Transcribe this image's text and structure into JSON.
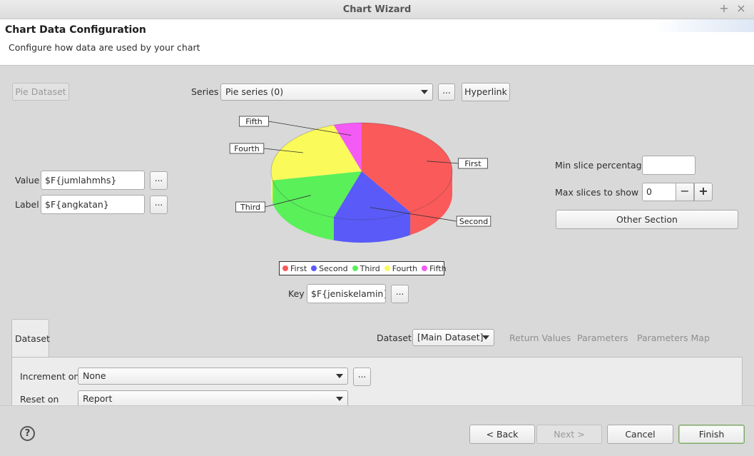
{
  "window": {
    "title": "Chart Wizard",
    "controls": [
      "+",
      "×"
    ]
  },
  "header": {
    "title": "Chart Data Configuration",
    "description": "Configure how data are used by your chart"
  },
  "dataset_button": {
    "label": "Pie Dataset"
  },
  "series": {
    "label": "Series",
    "selected": "Pie series (0)",
    "more_label": "...",
    "hyperlink_label": "Hyperlink"
  },
  "value": {
    "label": "Value",
    "expression": "$F{jumlahmhs}",
    "more_label": "..."
  },
  "label": {
    "label": "Label",
    "expression": "$F{angkatan}",
    "more_label": "..."
  },
  "key": {
    "label": "Key",
    "expression": "$F{jeniskelamin} +",
    "more_label": "..."
  },
  "min_slice": {
    "label": "Min slice percentage",
    "value": ""
  },
  "max_slices": {
    "label": "Max slices to show",
    "value": "0",
    "minus": "−",
    "plus": "+"
  },
  "other_section": {
    "label": "Other Section"
  },
  "chart_data": {
    "type": "pie",
    "labels": [
      "First",
      "Second",
      "Third",
      "Fourth",
      "Fifth"
    ],
    "values": [
      41,
      14,
      17,
      23,
      5
    ],
    "colors": [
      "#fa5a5a",
      "#5a5af8",
      "#5af05a",
      "#fafa5a",
      "#f45af4"
    ],
    "legend": "bottom",
    "style": "3d"
  },
  "tabs": {
    "dataset_tab": "Dataset",
    "dataset_label": "Dataset",
    "dataset_selected": "[Main Dataset]",
    "return_values": "Return Values",
    "parameters": "Parameters",
    "parameters_map": "Parameters Map"
  },
  "increment": {
    "label": "Increment on",
    "selected": "None",
    "more_label": "..."
  },
  "reset": {
    "label": "Reset on",
    "selected": "Report"
  },
  "footer": {
    "help": "?",
    "back": "< Back",
    "next": "Next >",
    "cancel": "Cancel",
    "finish": "Finish"
  }
}
